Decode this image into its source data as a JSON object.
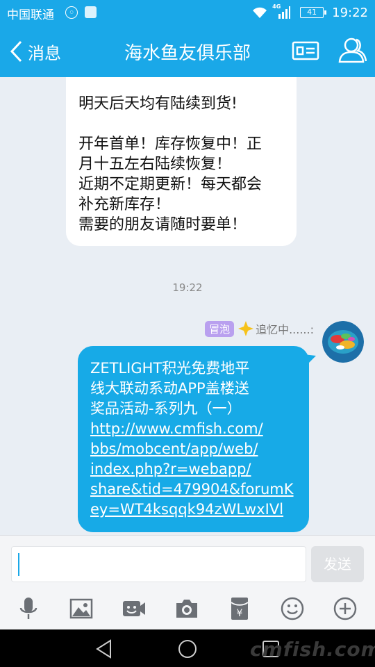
{
  "status_bar": {
    "carrier": "中国联通",
    "network": "4G",
    "battery": "41",
    "time": "19:22"
  },
  "header": {
    "back_label": "消息",
    "title": "海水鱼友俱乐部",
    "icons": [
      "profile-card-icon",
      "group-members-icon"
    ],
    "background_color": "#1aa8e8"
  },
  "messages": [
    {
      "direction": "incoming",
      "paragraphs": [
        [
          "明天后天均有陆续到货!"
        ],
        [
          "开年首单！库存恢复中！正",
          "月十五左右陆续恢复！",
          "近期不定期更新！每天都会",
          "补充新库存！",
          "需要的朋友请随时要单！"
        ]
      ]
    },
    {
      "direction": "outgoing",
      "timestamp": "19:22",
      "sender_badge": "冒泡",
      "sender_name": "追忆中......:",
      "text_lines": [
        "ZETLIGHT积光免费地平",
        "线大联动系动APP盖楼送",
        "奖品活动-系列九（一）"
      ],
      "link_lines": [
        "http://www.cmfish.com/",
        "bbs/mobcent/app/web/",
        "index.php?r=webapp/",
        "share&tid=479904&forumK",
        "ey=WT4ksqqk94zWLwxIVl"
      ],
      "bubble_color": "#17aae7"
    }
  ],
  "composer": {
    "input_value": "",
    "send_label": "发送"
  },
  "toolbar": {
    "icons": [
      "microphone-icon",
      "image-icon",
      "video-icon",
      "camera-icon",
      "red-packet-icon",
      "emoji-icon",
      "plus-icon"
    ]
  },
  "nav_bar": {
    "icons": [
      "back-triangle-icon",
      "home-circle-icon",
      "recents-square-icon"
    ],
    "watermark": "cmfish.com"
  }
}
